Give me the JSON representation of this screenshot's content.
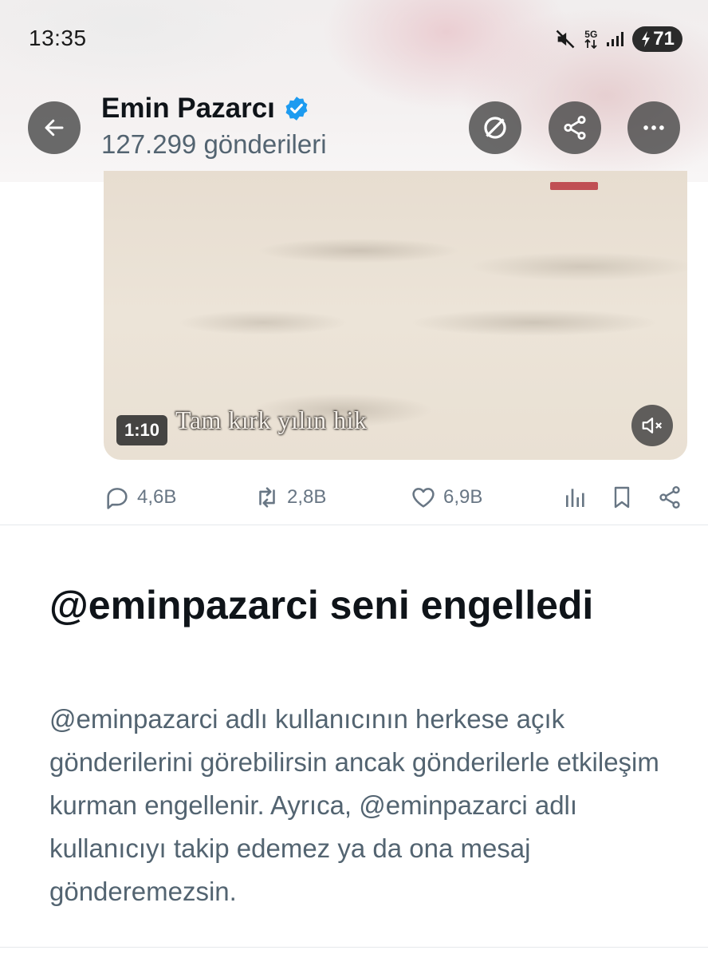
{
  "status_bar": {
    "time": "13:35",
    "network": "5G",
    "battery": "71",
    "icons": [
      "mute-icon",
      "network-5g-icon",
      "signal-icon",
      "battery-charging-icon"
    ]
  },
  "header": {
    "name": "Emin Pazarcı",
    "verified": true,
    "post_count": "127.299 gönderileri",
    "buttons": [
      "back-arrow-icon",
      "no-entry-icon",
      "share-icon",
      "more-icon"
    ]
  },
  "video": {
    "duration": "1:10",
    "subtitle": "Tam kırk yılın hik"
  },
  "actions": {
    "replies": "4,6B",
    "retweets": "2,8B",
    "likes": "6,9B"
  },
  "blocked": {
    "title": "@eminpazarci seni engelledi",
    "description": "@eminpazarci adlı kullanıcının herkese açık gönderilerini görebilirsin ancak gönderilerle etkileşim kurman engellenir. Ayrıca, @eminpazarci adlı kullanıcıyı takip edemez ya da ona mesaj gönderemezsin."
  },
  "colors": {
    "text_primary": "#0f1419",
    "text_secondary": "#536471",
    "verified_blue": "#1d9bf0",
    "icon_gray": "#687684"
  }
}
